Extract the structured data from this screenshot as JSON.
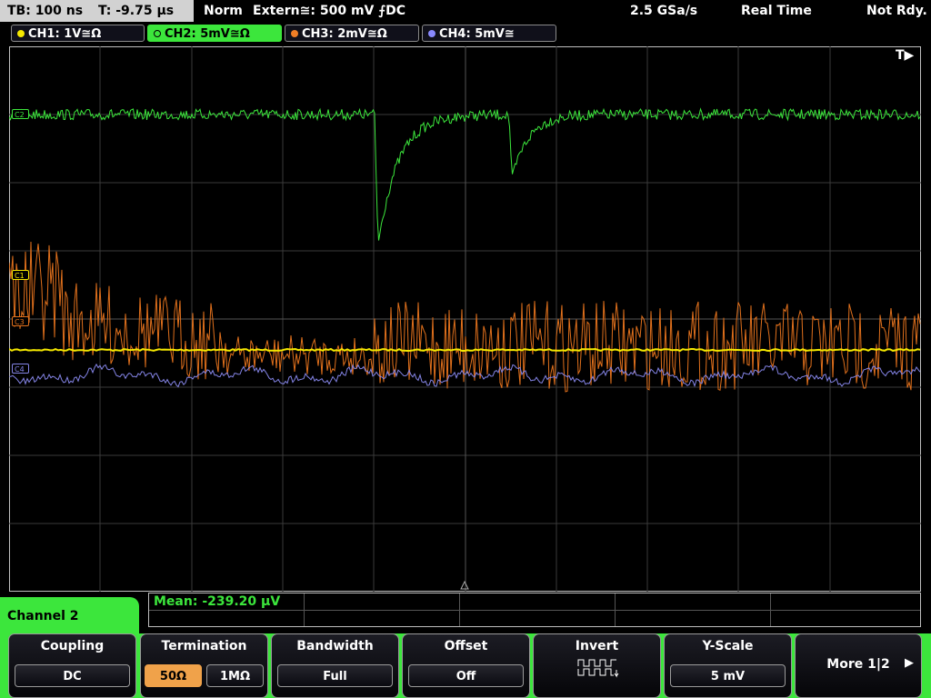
{
  "status_bar": {
    "timebase": "TB: 100 ns",
    "trigger_time": "T: -9.75 µs",
    "trigger_mode": "Norm",
    "trigger_source": "Extern≅: 500 mV ⨍DC",
    "sample_rate": "2.5 GSa/s",
    "acquisition_mode": "Real Time",
    "state": "Not Rdy."
  },
  "channel_tabs": [
    {
      "label": "CH1: 1V≅Ω",
      "color": "#f5e800"
    },
    {
      "label": "CH2: 5mV≅Ω",
      "color": "#3ce63c",
      "active": true
    },
    {
      "label": "CH3: 2mV≅Ω",
      "color": "#f07e26"
    },
    {
      "label": "CH4: 5mV≅",
      "color": "#8a8aff"
    }
  ],
  "trigger_indicator": "T▶",
  "markers": {
    "c1": "C1",
    "c2": "C2",
    "c3": "C3",
    "c4": "C4"
  },
  "colors": {
    "ch1": "#f5e800",
    "ch2": "#3ce63c",
    "ch3": "#e0701c",
    "ch4": "#8484e6",
    "grid": "#5a5a5a",
    "menu_accent": "#3ce63c"
  },
  "measurement": {
    "mean": "Mean: -239.20 µV"
  },
  "menu": {
    "title": "Channel 2",
    "coupling": {
      "label": "Coupling",
      "value": "DC"
    },
    "termination": {
      "label": "Termination",
      "opt1": "50Ω",
      "opt2": "1MΩ"
    },
    "bandwidth": {
      "label": "Bandwidth",
      "value": "Full"
    },
    "offset": {
      "label": "Offset",
      "value": "Off"
    },
    "invert": {
      "label": "Invert",
      "icon": "invert-waveform-icon"
    },
    "yscale": {
      "label": "Y-Scale",
      "value": "5 mV"
    },
    "more": {
      "label": "More 1|2",
      "arrow": "▶"
    }
  }
}
